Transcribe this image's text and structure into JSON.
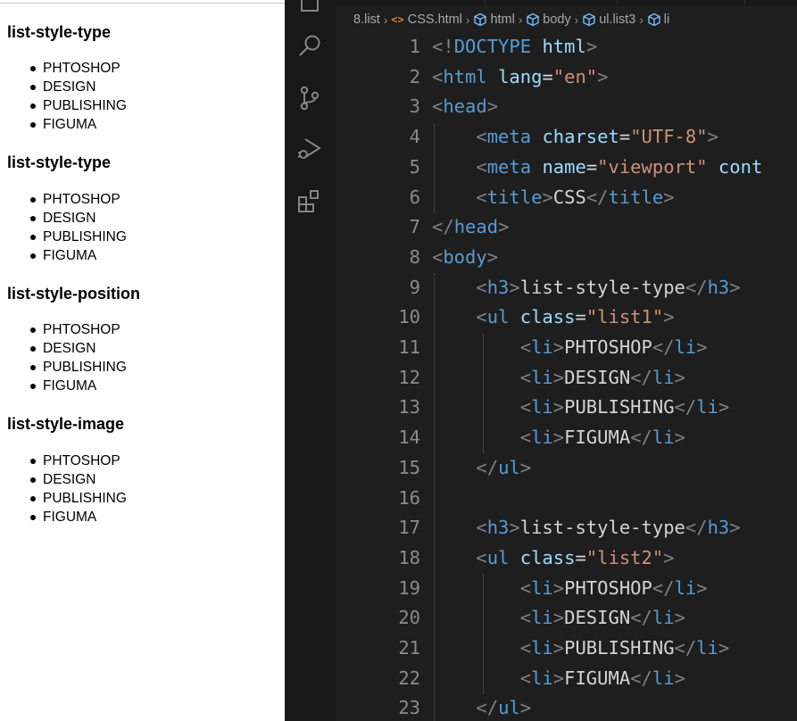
{
  "preview": {
    "sections": [
      {
        "heading": "list-style-type",
        "items": [
          "PHTOSHOP",
          "DESIGN",
          "PUBLISHING",
          "FIGUMA"
        ]
      },
      {
        "heading": "list-style-type",
        "items": [
          "PHTOSHOP",
          "DESIGN",
          "PUBLISHING",
          "FIGUMA"
        ]
      },
      {
        "heading": "list-style-position",
        "items": [
          "PHTOSHOP",
          "DESIGN",
          "PUBLISHING",
          "FIGUMA"
        ]
      },
      {
        "heading": "list-style-image",
        "items": [
          "PHTOSHOP",
          "DESIGN",
          "PUBLISHING",
          "FIGUMA"
        ]
      }
    ]
  },
  "activity_bar": {
    "icons": [
      "explorer-icon",
      "search-icon",
      "source-control-icon",
      "run-debug-icon",
      "extensions-icon"
    ]
  },
  "breadcrumb": {
    "folder": "8.list",
    "file": "CSS.html",
    "html": "html",
    "body": "body",
    "ul": "ul.list3",
    "li": "li"
  },
  "editor": {
    "line_numbers": [
      "1",
      "2",
      "3",
      "4",
      "5",
      "6",
      "7",
      "8",
      "9",
      "10",
      "11",
      "12",
      "13",
      "14",
      "15",
      "16",
      "17",
      "18",
      "19",
      "20",
      "21",
      "22",
      "23"
    ],
    "lines": [
      [
        [
          "p",
          "<!"
        ],
        [
          "t",
          "DOCTYPE"
        ],
        [
          "x",
          " "
        ],
        [
          "a",
          "html"
        ],
        [
          "p",
          ">"
        ]
      ],
      [
        [
          "p",
          "<"
        ],
        [
          "t",
          "html"
        ],
        [
          "x",
          " "
        ],
        [
          "a",
          "lang"
        ],
        [
          "x",
          "="
        ],
        [
          "s",
          "\"en\""
        ],
        [
          "p",
          ">"
        ]
      ],
      [
        [
          "p",
          "<"
        ],
        [
          "t",
          "head"
        ],
        [
          "p",
          ">"
        ]
      ],
      [
        [
          "x",
          "    "
        ],
        [
          "p",
          "<"
        ],
        [
          "t",
          "meta"
        ],
        [
          "x",
          " "
        ],
        [
          "a",
          "charset"
        ],
        [
          "x",
          "="
        ],
        [
          "s",
          "\"UTF-8\""
        ],
        [
          "p",
          ">"
        ]
      ],
      [
        [
          "x",
          "    "
        ],
        [
          "p",
          "<"
        ],
        [
          "t",
          "meta"
        ],
        [
          "x",
          " "
        ],
        [
          "a",
          "name"
        ],
        [
          "x",
          "="
        ],
        [
          "s",
          "\"viewport\""
        ],
        [
          "x",
          " "
        ],
        [
          "a",
          "cont"
        ]
      ],
      [
        [
          "x",
          "    "
        ],
        [
          "p",
          "<"
        ],
        [
          "t",
          "title"
        ],
        [
          "p",
          ">"
        ],
        [
          "x",
          "CSS"
        ],
        [
          "p",
          "</"
        ],
        [
          "t",
          "title"
        ],
        [
          "p",
          ">"
        ]
      ],
      [
        [
          "p",
          "</"
        ],
        [
          "t",
          "head"
        ],
        [
          "p",
          ">"
        ]
      ],
      [
        [
          "p",
          "<"
        ],
        [
          "t",
          "body"
        ],
        [
          "p",
          ">"
        ]
      ],
      [
        [
          "x",
          "    "
        ],
        [
          "p",
          "<"
        ],
        [
          "t",
          "h3"
        ],
        [
          "p",
          ">"
        ],
        [
          "x",
          "list-style-type"
        ],
        [
          "p",
          "</"
        ],
        [
          "t",
          "h3"
        ],
        [
          "p",
          ">"
        ]
      ],
      [
        [
          "x",
          "    "
        ],
        [
          "p",
          "<"
        ],
        [
          "t",
          "ul"
        ],
        [
          "x",
          " "
        ],
        [
          "a",
          "class"
        ],
        [
          "x",
          "="
        ],
        [
          "s",
          "\"list1\""
        ],
        [
          "p",
          ">"
        ]
      ],
      [
        [
          "x",
          "        "
        ],
        [
          "p",
          "<"
        ],
        [
          "t",
          "li"
        ],
        [
          "p",
          ">"
        ],
        [
          "x",
          "PHTOSHOP"
        ],
        [
          "p",
          "</"
        ],
        [
          "t",
          "li"
        ],
        [
          "p",
          ">"
        ]
      ],
      [
        [
          "x",
          "        "
        ],
        [
          "p",
          "<"
        ],
        [
          "t",
          "li"
        ],
        [
          "p",
          ">"
        ],
        [
          "x",
          "DESIGN"
        ],
        [
          "p",
          "</"
        ],
        [
          "t",
          "li"
        ],
        [
          "p",
          ">"
        ]
      ],
      [
        [
          "x",
          "        "
        ],
        [
          "p",
          "<"
        ],
        [
          "t",
          "li"
        ],
        [
          "p",
          ">"
        ],
        [
          "x",
          "PUBLISHING"
        ],
        [
          "p",
          "</"
        ],
        [
          "t",
          "li"
        ],
        [
          "p",
          ">"
        ]
      ],
      [
        [
          "x",
          "        "
        ],
        [
          "p",
          "<"
        ],
        [
          "t",
          "li"
        ],
        [
          "p",
          ">"
        ],
        [
          "x",
          "FIGUMA"
        ],
        [
          "p",
          "</"
        ],
        [
          "t",
          "li"
        ],
        [
          "p",
          ">"
        ]
      ],
      [
        [
          "x",
          "    "
        ],
        [
          "p",
          "</"
        ],
        [
          "t",
          "ul"
        ],
        [
          "p",
          ">"
        ]
      ],
      [],
      [
        [
          "x",
          "    "
        ],
        [
          "p",
          "<"
        ],
        [
          "t",
          "h3"
        ],
        [
          "p",
          ">"
        ],
        [
          "x",
          "list-style-type"
        ],
        [
          "p",
          "</"
        ],
        [
          "t",
          "h3"
        ],
        [
          "p",
          ">"
        ]
      ],
      [
        [
          "x",
          "    "
        ],
        [
          "p",
          "<"
        ],
        [
          "t",
          "ul"
        ],
        [
          "x",
          " "
        ],
        [
          "a",
          "class"
        ],
        [
          "x",
          "="
        ],
        [
          "s",
          "\"list2\""
        ],
        [
          "p",
          ">"
        ]
      ],
      [
        [
          "x",
          "        "
        ],
        [
          "p",
          "<"
        ],
        [
          "t",
          "li"
        ],
        [
          "p",
          ">"
        ],
        [
          "x",
          "PHTOSHOP"
        ],
        [
          "p",
          "</"
        ],
        [
          "t",
          "li"
        ],
        [
          "p",
          ">"
        ]
      ],
      [
        [
          "x",
          "        "
        ],
        [
          "p",
          "<"
        ],
        [
          "t",
          "li"
        ],
        [
          "p",
          ">"
        ],
        [
          "x",
          "DESIGN"
        ],
        [
          "p",
          "</"
        ],
        [
          "t",
          "li"
        ],
        [
          "p",
          ">"
        ]
      ],
      [
        [
          "x",
          "        "
        ],
        [
          "p",
          "<"
        ],
        [
          "t",
          "li"
        ],
        [
          "p",
          ">"
        ],
        [
          "x",
          "PUBLISHING"
        ],
        [
          "p",
          "</"
        ],
        [
          "t",
          "li"
        ],
        [
          "p",
          ">"
        ]
      ],
      [
        [
          "x",
          "        "
        ],
        [
          "p",
          "<"
        ],
        [
          "t",
          "li"
        ],
        [
          "p",
          ">"
        ],
        [
          "x",
          "FIGUMA"
        ],
        [
          "p",
          "</"
        ],
        [
          "t",
          "li"
        ],
        [
          "p",
          ">"
        ]
      ],
      [
        [
          "x",
          "    "
        ],
        [
          "p",
          "</"
        ],
        [
          "t",
          "ul"
        ],
        [
          "p",
          ">"
        ]
      ]
    ]
  },
  "colors": {
    "editor_bg": "#1e1e1e",
    "activity_bg": "#181818",
    "tag": "#569cd6",
    "attribute": "#9cdcfe",
    "string": "#ce9178",
    "bracket": "#808080",
    "text": "#d4d4d4",
    "line_number": "#8b8b8b",
    "html_icon": "#e37933",
    "symbol_icon": "#75beff"
  }
}
